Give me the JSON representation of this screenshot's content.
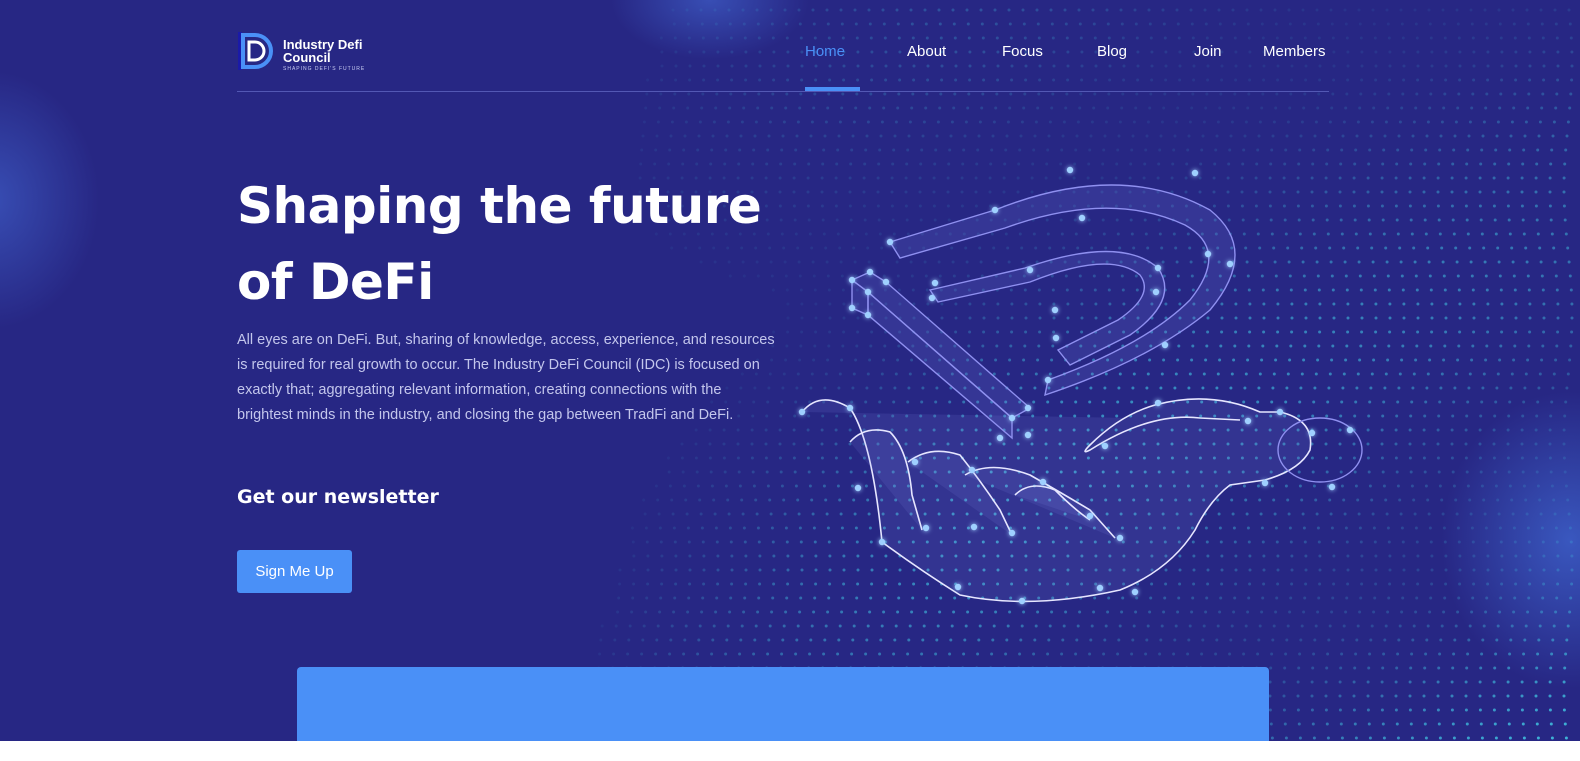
{
  "brand": {
    "name": "Industry Defi Council",
    "tagline": "SHAPING DEFI'S FUTURE"
  },
  "nav": {
    "items": [
      {
        "label": "Home",
        "active": true
      },
      {
        "label": "About",
        "active": false
      },
      {
        "label": "Focus",
        "active": false
      },
      {
        "label": "Blog",
        "active": false
      },
      {
        "label": "Join",
        "active": false
      },
      {
        "label": "Members",
        "active": false
      }
    ]
  },
  "hero": {
    "headline_line1": "Shaping the future",
    "headline_line2": "of DeFi",
    "intro": "All eyes are on DeFi. But, sharing of knowledge, access, experience, and resources is required for real growth to occur. The Industry DeFi Council (IDC) is focused on exactly that; aggregating relevant information, creating connections with the brightest minds in the industry, and closing the gap between TradFi and DeFi.",
    "newsletter_heading": "Get our newsletter",
    "cta_label": "Sign Me Up"
  },
  "colors": {
    "background": "#272784",
    "accent": "#4a90f7",
    "text": "#ffffff",
    "muted_text": "#c3c6ec",
    "dot": "#3fb6d9"
  },
  "icons": {
    "logo": "idc-logo-mark",
    "illustration": "wireframe-hand-holding-d-icon"
  }
}
